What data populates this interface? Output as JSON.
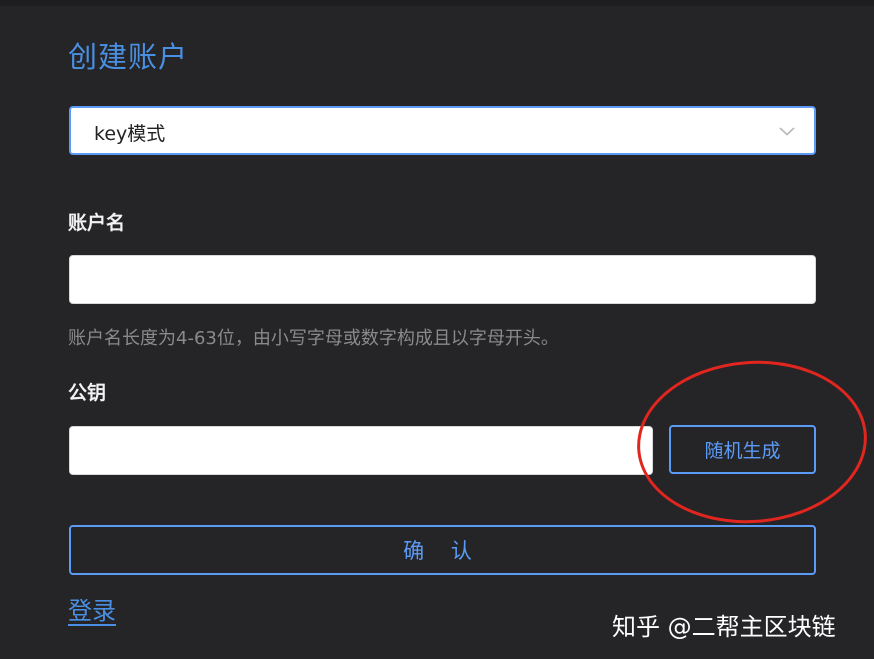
{
  "form": {
    "title": "创建账户",
    "mode_select": {
      "value": "key模式",
      "icon": "chevron-down-icon"
    },
    "account_name": {
      "label": "账户名",
      "value": "",
      "hint": "账户名长度为4-63位，由小写字母或数字构成且以字母开头。"
    },
    "public_key": {
      "label": "公钥",
      "value": "",
      "random_button_label": "随机生成"
    },
    "confirm_button_label": "确 认",
    "login_link_label": "登录"
  },
  "watermark": "知乎 @二帮主区块链",
  "colors": {
    "background": "#252427",
    "accent": "#5b9bf5",
    "title": "#4a90e2",
    "annotation": "#e0261f",
    "hint": "#8a8a8a"
  }
}
